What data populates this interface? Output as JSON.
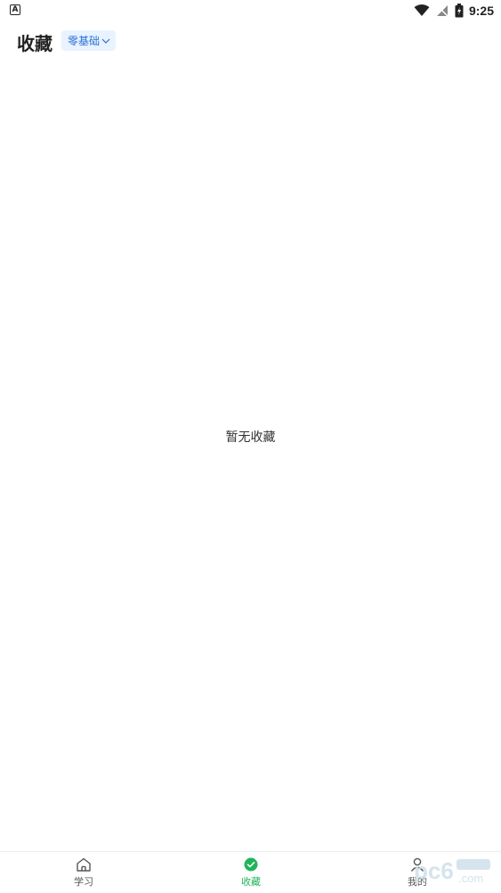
{
  "status_bar": {
    "left_icon": "A",
    "time": "9:25",
    "icons": [
      "wifi-icon",
      "signal-icon",
      "battery-icon"
    ]
  },
  "header": {
    "title": "收藏",
    "level_selector": "零基础"
  },
  "empty_state": {
    "message": "暂无收藏"
  },
  "bottom_nav": {
    "items": [
      {
        "label": "学习",
        "icon": "home-icon",
        "active": false
      },
      {
        "label": "收藏",
        "icon": "check-circle-icon",
        "active": true
      },
      {
        "label": "我的",
        "icon": "person-icon",
        "active": false
      }
    ]
  },
  "colors": {
    "accent_green": "#21b45a",
    "chip_text": "#2b6fd6",
    "chip_bg": "#e8f3ff"
  },
  "watermark": {
    "text": "pc6.com"
  }
}
